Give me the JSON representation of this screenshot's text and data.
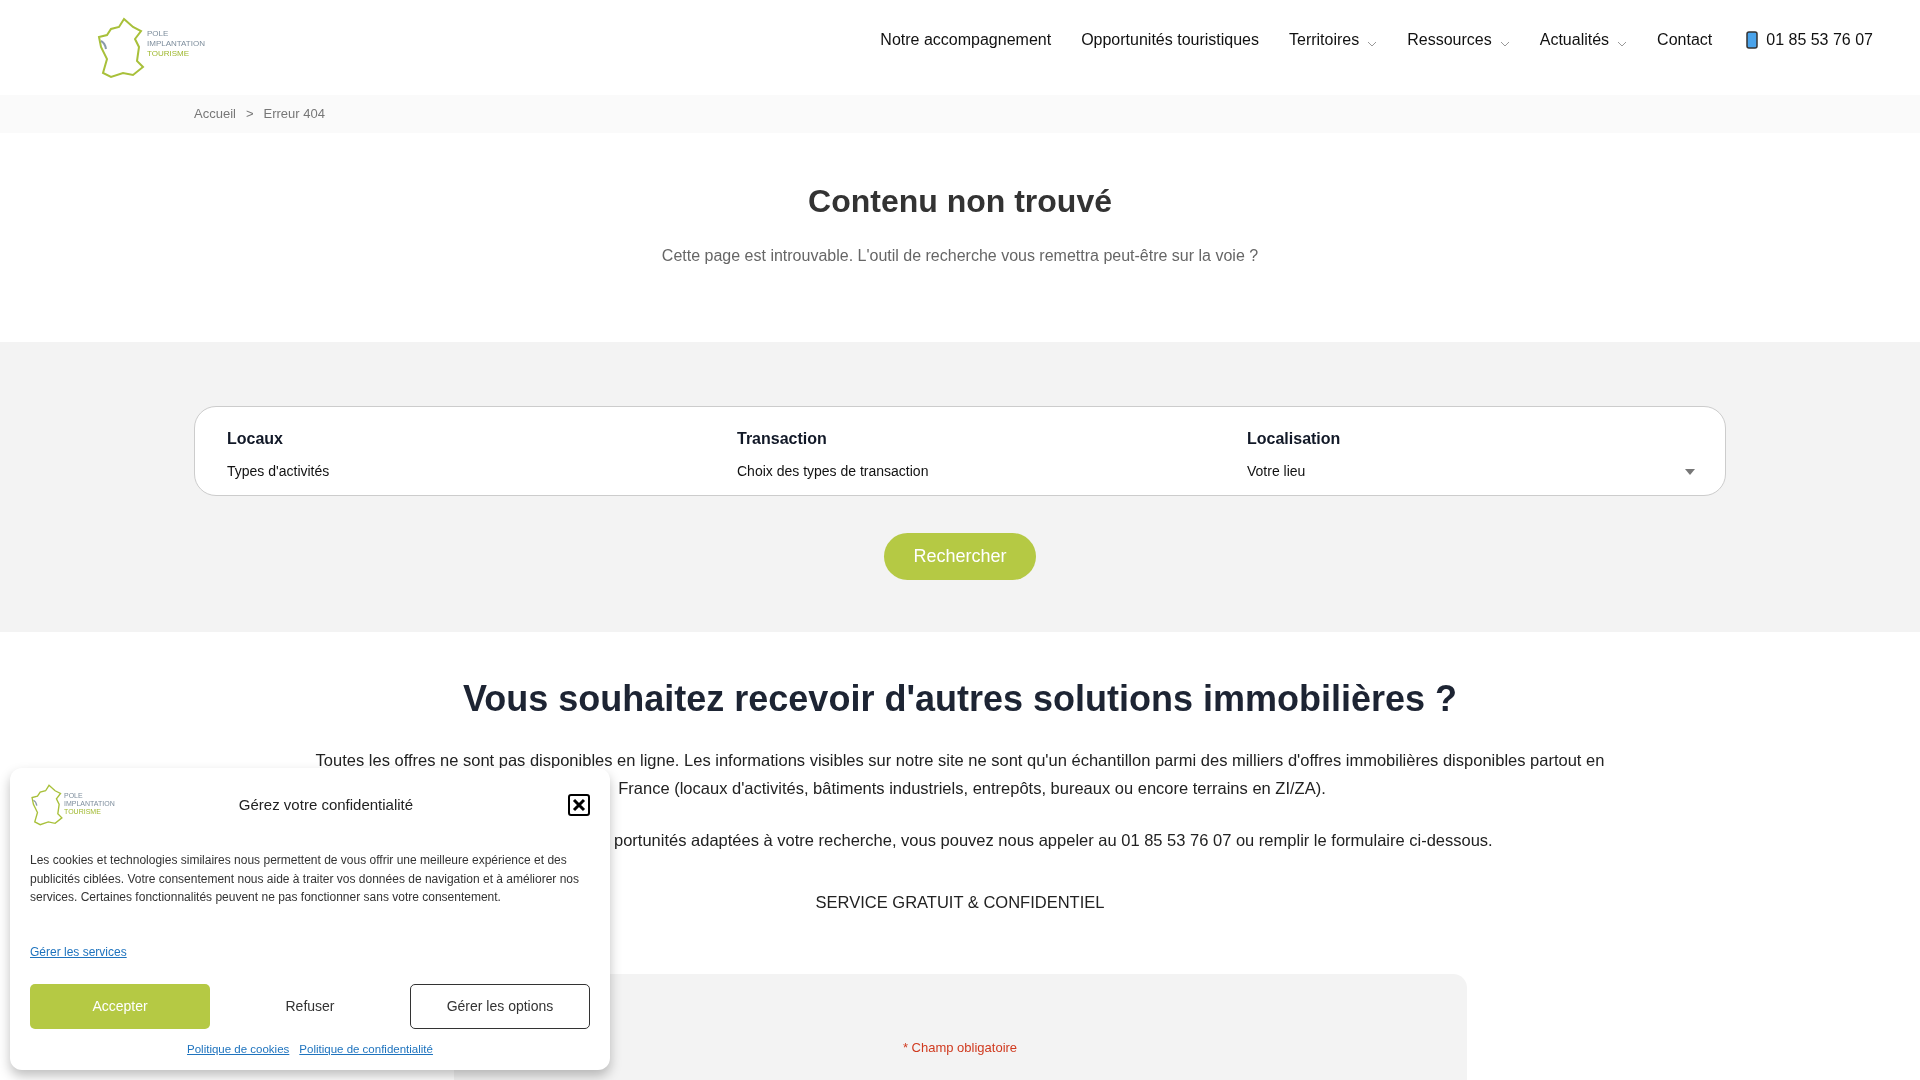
{
  "header": {
    "logo_lines": [
      "POLE",
      "IMPLANTATION",
      "TOURISME"
    ],
    "nav": [
      {
        "label": "Notre accompagnement",
        "has_menu": false
      },
      {
        "label": "Opportunités touristiques",
        "has_menu": false
      },
      {
        "label": "Territoires",
        "has_menu": true
      },
      {
        "label": "Ressources",
        "has_menu": true
      },
      {
        "label": "Actualités",
        "has_menu": true
      },
      {
        "label": "Contact",
        "has_menu": false
      }
    ],
    "phone": "01 85 53 76 07"
  },
  "breadcrumb": {
    "items": [
      "Accueil",
      "Erreur 404"
    ],
    "separator": ">"
  },
  "not_found": {
    "title": "Contenu non trouvé",
    "text": "Cette page est introuvable. L'outil de recherche vous remettra peut-être sur la voie ?"
  },
  "search": {
    "fields": [
      {
        "label": "Locaux",
        "value": "Types d'activités",
        "has_caret": false
      },
      {
        "label": "Transaction",
        "value": "Choix des types de transaction",
        "has_caret": false
      },
      {
        "label": "Localisation",
        "value": "Votre lieu",
        "has_caret": true
      }
    ],
    "button": "Rechercher"
  },
  "more": {
    "title": "Vous souhaitez recevoir d'autres solutions immobilières ?",
    "paragraph_lines": [
      "Toutes les offres ne sont pas disponibles en ligne. Les informations visibles sur notre site ne sont qu'un échantillon parmi des milliers d'offres immobilières disponibles partout en",
      "France (locaux d'activités, bâtiments industriels, entrepôts, bureaux ou encore terrains en ZI/ZA)."
    ],
    "paragraph_cut": "portunités adaptées à votre recherche, vous pouvez nous appeler au 01 85 53 76 07 ou remplir le formulaire ci-dessous.",
    "service": "SERVICE GRATUIT & CONFIDENTIEL",
    "required_note": "* Champ obligatoire"
  },
  "cookie_dialog": {
    "logo_lines": [
      "POLE",
      "IMPLANTATION",
      "TOURISME"
    ],
    "title": "Gérez votre confidentialité",
    "text": "Les cookies et technologies similaires nous permettent de vous offrir une meilleure expérience et des publicités ciblées. Votre consentement nous aide à traiter vos données de navigation et à améliorer nos services. Certaines fonctionnalités peuvent ne pas fonctionner sans votre consentement.",
    "manage_link": "Gérer les services",
    "buttons": [
      {
        "label": "Accepter",
        "kind": "primary"
      },
      {
        "label": "Refuser",
        "kind": "plain"
      },
      {
        "label": "Gérer les options",
        "kind": "outline"
      }
    ],
    "links": [
      "Politique de cookies",
      "Politique de confidentialité"
    ]
  }
}
